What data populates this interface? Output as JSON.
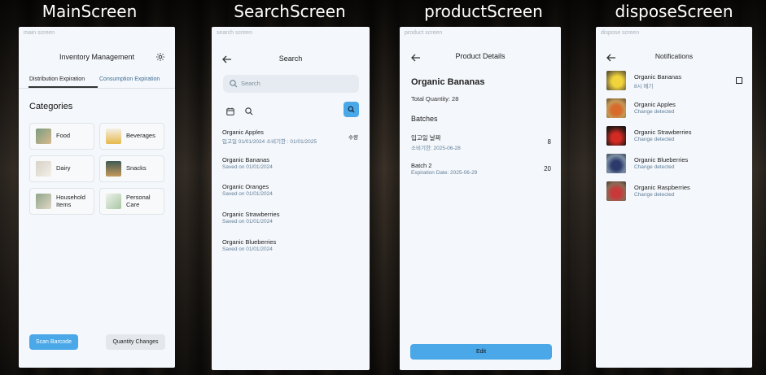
{
  "titles": {
    "main": "MainScreen",
    "search": "SearchScreen",
    "product": "productScreen",
    "dispose": "disposeScreen"
  },
  "main": {
    "tag": "main screen",
    "header": "Inventory Management",
    "tabs": [
      "Distribution Expiration",
      "Consumption Expiration"
    ],
    "section": "Categories",
    "categories": [
      {
        "label": "Food",
        "icon": "food-thumbnail"
      },
      {
        "label": "Beverages",
        "icon": "beverages-thumbnail"
      },
      {
        "label": "Dairy",
        "icon": "dairy-thumbnail"
      },
      {
        "label": "Snacks",
        "icon": "snacks-thumbnail"
      },
      {
        "label": "Household Items",
        "icon": "household-thumbnail"
      },
      {
        "label": "Personal Care",
        "icon": "personal-care-thumbnail"
      }
    ],
    "scan_button": "Scan Barcode",
    "quantity_button": "Quantity Changes"
  },
  "search": {
    "tag": "search screen",
    "header": "Search",
    "placeholder": "Search",
    "quantity_label": "수량",
    "items": [
      {
        "title": "Organic Apples",
        "sub": "입고일 01/01/2024   소비기한 : 01/01/2025"
      },
      {
        "title": "Organic Bananas",
        "sub": "Saved on 01/01/2024"
      },
      {
        "title": "Organic Oranges",
        "sub": "Saved on 01/01/2024"
      },
      {
        "title": "Organic Strawberries",
        "sub": "Saved on 01/01/2024"
      },
      {
        "title": "Organic Blueberries",
        "sub": "Saved on 01/01/2024"
      }
    ]
  },
  "product": {
    "tag": "product screen",
    "header": "Product Details",
    "name": "Organic Bananas",
    "total": "Total Quantity: 28",
    "batches_title": "Batches",
    "batches": [
      {
        "title": "입고일 날짜",
        "sub": "소비기한: 2025-06-28",
        "qty": "8"
      },
      {
        "title": "Batch 2",
        "sub": "Expiration Date: 2025-06-29",
        "qty": "20"
      }
    ],
    "edit_button": "Edit"
  },
  "dispose": {
    "tag": "dispose screen",
    "header": "Notifications",
    "items": [
      {
        "title": "Organic Bananas",
        "sub": "8시 메기"
      },
      {
        "title": "Organic Apples",
        "sub": "Change detected"
      },
      {
        "title": "Organic Strawberries",
        "sub": "Change detected"
      },
      {
        "title": "Organic Blueberries",
        "sub": "Change detected"
      },
      {
        "title": "Organic Raspberries",
        "sub": "Change detected"
      }
    ]
  },
  "colors": {
    "accent": "#4aa8e8",
    "subtext": "#5f7d98",
    "screen_bg": "#f4f7fb"
  }
}
